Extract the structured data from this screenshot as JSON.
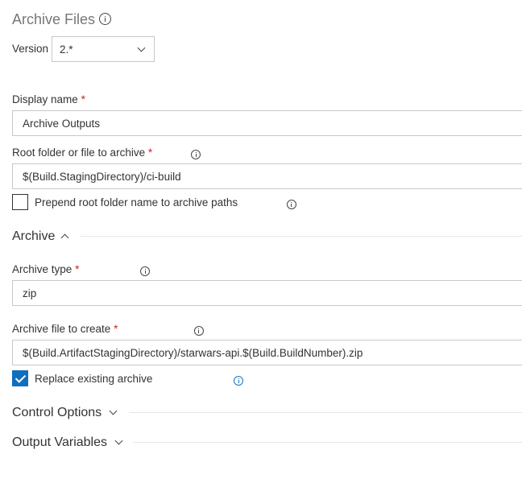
{
  "title": "Archive Files",
  "version": {
    "label": "Version",
    "value": "2.*"
  },
  "display_name": {
    "label": "Display name",
    "required": "*",
    "value": "Archive Outputs"
  },
  "root_folder": {
    "label": "Root folder or file to archive",
    "required": "*",
    "value": "$(Build.StagingDirectory)/ci-build"
  },
  "prepend_root": {
    "label": "Prepend root folder name to archive paths",
    "checked": false
  },
  "archive_section": {
    "label": "Archive",
    "expanded": true
  },
  "archive_type": {
    "label": "Archive type",
    "required": "*",
    "value": "zip"
  },
  "archive_file": {
    "label": "Archive file to create",
    "required": "*",
    "value": "$(Build.ArtifactStagingDirectory)/starwars-api.$(Build.BuildNumber).zip"
  },
  "replace_existing": {
    "label": "Replace existing archive",
    "checked": true
  },
  "control_options": {
    "label": "Control Options",
    "expanded": false
  },
  "output_variables": {
    "label": "Output Variables",
    "expanded": false
  },
  "colors": {
    "accent": "#106ebe",
    "required": "#c4262e",
    "title": "#777777",
    "border": "#c8c8c8"
  },
  "icons": {
    "info": "info-circle-icon",
    "chevron_down": "chevron-down-icon",
    "chevron_up": "chevron-up-icon",
    "check": "checkmark-icon"
  }
}
